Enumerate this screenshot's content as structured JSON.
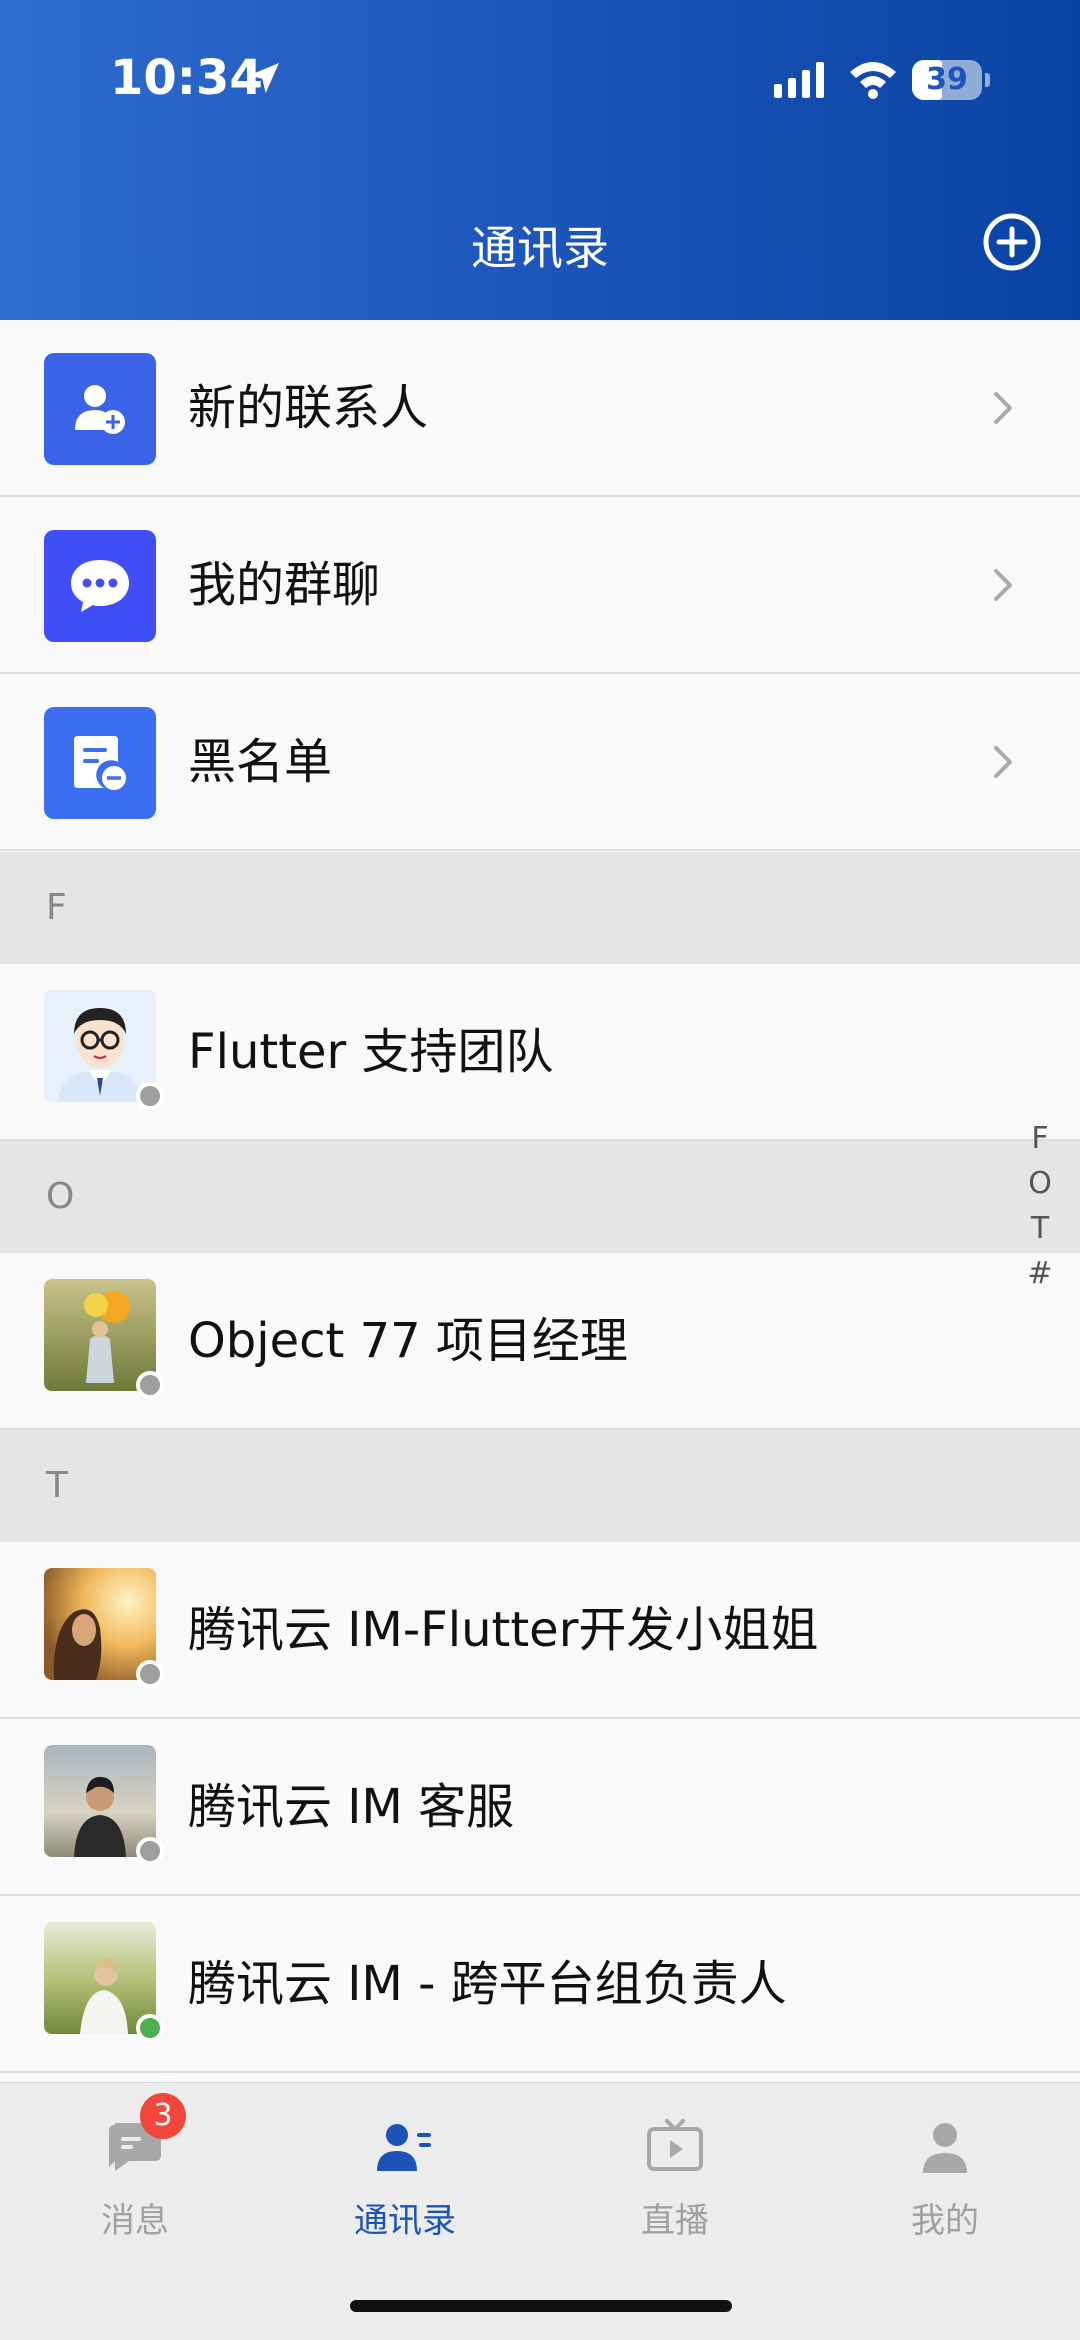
{
  "status_bar": {
    "time": "10:34",
    "battery": "39"
  },
  "header": {
    "title": "通讯录"
  },
  "menu": [
    {
      "label": "新的联系人",
      "icon": "add-contact-icon",
      "color": "#3a63e8"
    },
    {
      "label": "我的群聊",
      "icon": "group-chat-icon",
      "color": "#3f4ff5"
    },
    {
      "label": "黑名单",
      "icon": "blacklist-icon",
      "color": "#3b6ef0"
    }
  ],
  "sections": [
    {
      "letter": "F",
      "contacts": [
        {
          "name": "Flutter 支持团队",
          "status": "offline"
        }
      ]
    },
    {
      "letter": "O",
      "contacts": [
        {
          "name": "Object 77 项目经理",
          "status": "offline"
        }
      ]
    },
    {
      "letter": "T",
      "contacts": [
        {
          "name": "腾讯云 IM-Flutter开发小姐姐",
          "status": "offline"
        },
        {
          "name": "腾讯云 IM 客服",
          "status": "offline"
        },
        {
          "name": "腾讯云 IM - 跨平台组负责人",
          "status": "online"
        }
      ]
    }
  ],
  "index_bar": [
    "F",
    "O",
    "T",
    "#"
  ],
  "tabs": [
    {
      "label": "消息",
      "icon": "message-icon",
      "badge": "3",
      "active": false
    },
    {
      "label": "通讯录",
      "icon": "contacts-icon",
      "active": true
    },
    {
      "label": "直播",
      "icon": "live-tv-icon",
      "active": false
    },
    {
      "label": "我的",
      "icon": "profile-icon",
      "active": false
    }
  ],
  "colors": {
    "header_start": "#2f6dd0",
    "header_end": "#0843a2",
    "active_tab": "#1d52b7",
    "badge": "#f2463d",
    "online": "#4cb050",
    "offline": "#9e9e9e"
  }
}
